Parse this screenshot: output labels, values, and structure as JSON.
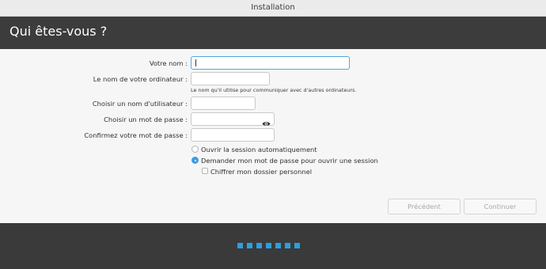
{
  "window": {
    "title": "Installation"
  },
  "header": {
    "title": "Qui êtes-vous ?"
  },
  "form": {
    "name_label": "Votre nom :",
    "name_value": "",
    "computer_label": "Le nom de votre ordinateur :",
    "computer_value": "",
    "computer_hint": "Le nom qu'il utilise pour communiquer avec d'autres ordinateurs.",
    "username_label": "Choisir un nom d'utilisateur :",
    "username_value": "",
    "password_label": "Choisir un mot de passe :",
    "password_value": "",
    "confirm_label": "Confirmez votre mot de passe :",
    "confirm_value": ""
  },
  "login_options": {
    "auto_login": "Ouvrir la session automatiquement",
    "require_password": "Demander mon mot de passe pour ouvrir une session",
    "selected": "require_password",
    "encrypt_home": "Chiffrer mon dossier personnel",
    "encrypt_home_checked": false
  },
  "buttons": {
    "back": "Précédent",
    "continue": "Continuer"
  },
  "progress": {
    "steps": 7,
    "current_step": 7
  },
  "colors": {
    "accent": "#2e9ddf",
    "header_bg": "#3c3c3c",
    "focus_border": "#52a8d9"
  },
  "icons": {
    "password_toggle": "eye-icon"
  }
}
